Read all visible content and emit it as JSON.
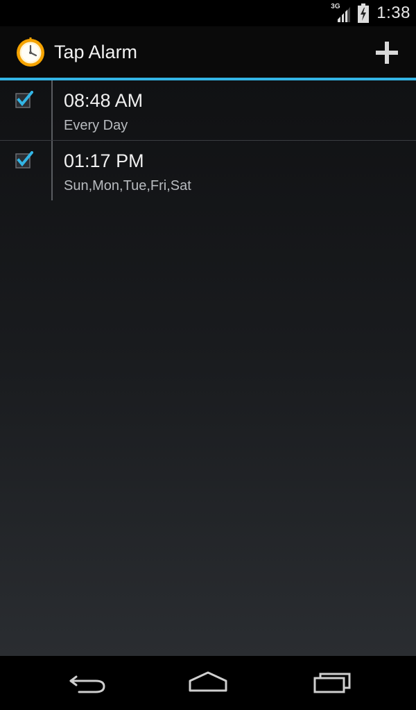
{
  "status_bar": {
    "network_type": "3G",
    "time": "1:38",
    "icons": [
      "signal-icon",
      "battery-charging-icon"
    ]
  },
  "action_bar": {
    "title": "Tap Alarm",
    "app_icon": "alarm-clock-icon",
    "add_icon": "plus-icon"
  },
  "alarms": [
    {
      "time": "08:48 AM",
      "days": "Every Day",
      "enabled": true
    },
    {
      "time": "01:17 PM",
      "days": "Sun,Mon,Tue,Fri,Sat",
      "enabled": true
    }
  ],
  "nav_bar": {
    "icons": [
      "back-icon",
      "home-icon",
      "recent-apps-icon"
    ]
  },
  "colors": {
    "accent": "#33b5e5",
    "app_icon_ring": "#f5a300",
    "checkmark": "#33b5e5"
  }
}
